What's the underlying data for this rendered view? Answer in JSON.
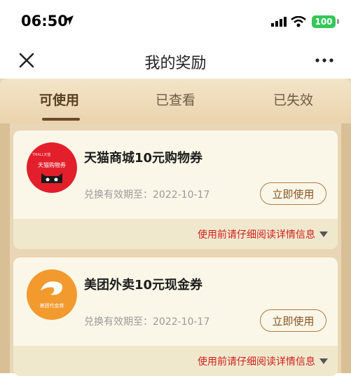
{
  "status_bar": {
    "time": "06:50",
    "battery": "100"
  },
  "header": {
    "title": "我的奖励"
  },
  "tabs": [
    {
      "label": "可使用"
    },
    {
      "label": "已查看"
    },
    {
      "label": "已失效"
    }
  ],
  "cards": [
    {
      "title": "天猫商城10元购物券",
      "expiry": "兑换有效期至：2022-10-17",
      "button": "立即使用",
      "detail": "使用前请仔细阅读详情信息",
      "logo_text": "天猫购物券",
      "logo_brand": "TMALL天猫",
      "logo_color": "#e31f2c"
    },
    {
      "title": "美团外卖10元现金券",
      "expiry": "兑换有效期至：2022-10-17",
      "button": "立即使用",
      "detail": "使用前请仔细阅读详情信息",
      "logo_text": "美团代金券",
      "logo_color": "#f29a2e"
    }
  ],
  "colors": {
    "accent": "#8a5224",
    "detail_red": "#cf1e1e",
    "card_bg": "#fbf7e8"
  }
}
